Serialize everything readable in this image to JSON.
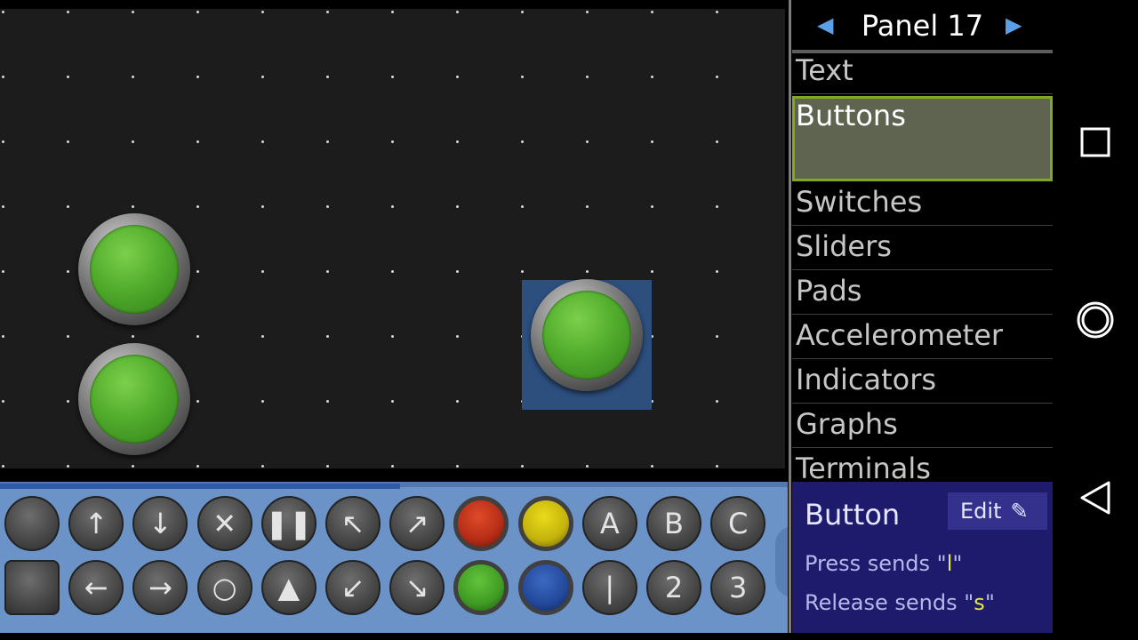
{
  "panel": {
    "title": "Panel 17",
    "prev_icon": "triangle-left-icon",
    "next_icon": "triangle-right-icon"
  },
  "categories": [
    {
      "label": "Text",
      "selected": false
    },
    {
      "label": "Buttons",
      "selected": true
    },
    {
      "label": "Switches",
      "selected": false
    },
    {
      "label": "Sliders",
      "selected": false
    },
    {
      "label": "Pads",
      "selected": false
    },
    {
      "label": "Accelerometer",
      "selected": false
    },
    {
      "label": "Indicators",
      "selected": false
    },
    {
      "label": "Graphs",
      "selected": false
    },
    {
      "label": "Terminals",
      "selected": false
    }
  ],
  "palette": {
    "row1": [
      {
        "name": "plain-button",
        "label": ""
      },
      {
        "name": "up-arrow-button",
        "label": "↑"
      },
      {
        "name": "down-arrow-button",
        "label": "↓"
      },
      {
        "name": "cross-button",
        "label": "✕"
      },
      {
        "name": "pause-button",
        "label": "❚❚"
      },
      {
        "name": "up-left-arrow-button",
        "label": "↖"
      },
      {
        "name": "up-right-arrow-button",
        "label": "↗"
      },
      {
        "name": "red-button",
        "label": ""
      },
      {
        "name": "yellow-button",
        "label": ""
      },
      {
        "name": "a-button",
        "label": "A"
      },
      {
        "name": "b-button",
        "label": "B"
      },
      {
        "name": "c-button",
        "label": "C"
      }
    ],
    "row2": [
      {
        "name": "square-button",
        "label": ""
      },
      {
        "name": "left-arrow-button",
        "label": "←"
      },
      {
        "name": "right-arrow-button",
        "label": "→"
      },
      {
        "name": "circle-button",
        "label": "○"
      },
      {
        "name": "triangle-button",
        "label": "▲"
      },
      {
        "name": "down-left-arrow-button",
        "label": "↙"
      },
      {
        "name": "down-right-arrow-button",
        "label": "↘"
      },
      {
        "name": "green-button",
        "label": ""
      },
      {
        "name": "blue-button",
        "label": ""
      },
      {
        "name": "one-button",
        "label": "|"
      },
      {
        "name": "two-button",
        "label": "2"
      },
      {
        "name": "three-button",
        "label": "3"
      }
    ]
  },
  "info": {
    "name": "Button",
    "edit_label": "Edit",
    "press_prefix": "Press sends \"",
    "press_value": "l",
    "press_suffix": "\"",
    "release_prefix": "Release sends \"",
    "release_value": "s",
    "release_suffix": "\""
  },
  "nav": {
    "recents_icon": "square-icon",
    "home_icon": "circle-icon",
    "back_icon": "triangle-back-icon"
  }
}
